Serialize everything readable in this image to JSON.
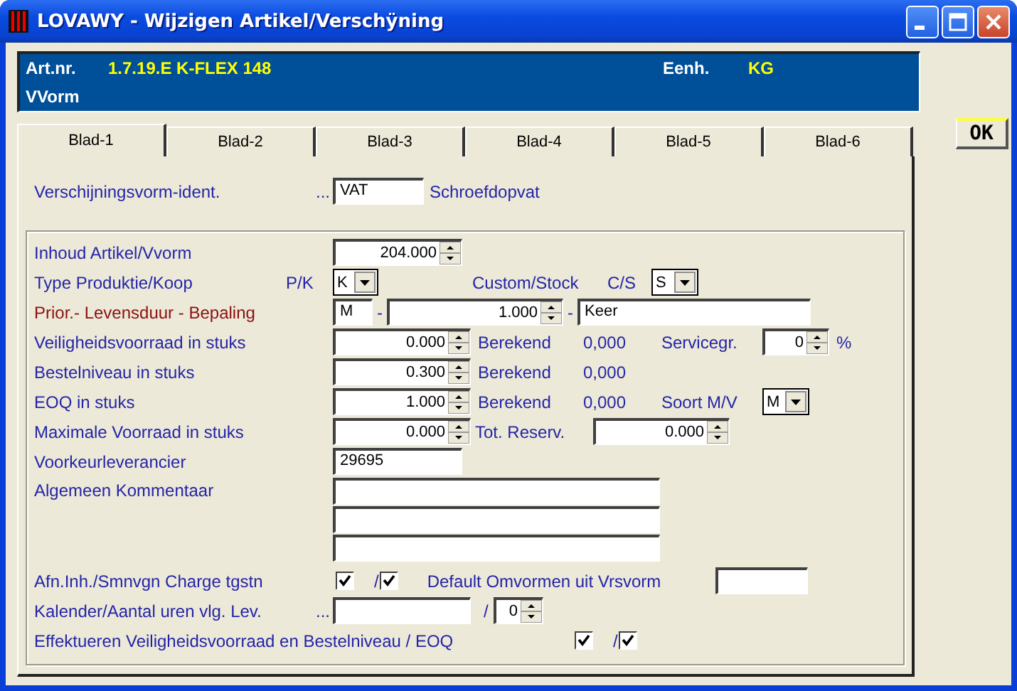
{
  "window": {
    "title": "LOVAWY - Wijzigen Artikel/Verschÿning"
  },
  "header": {
    "article_label": "Art.nr.",
    "article_value": "1.7.19.E  K-FLEX 148",
    "unit_label": "Eenh.",
    "unit_value": "KG",
    "form_label": "VVorm"
  },
  "tabs": [
    {
      "label": "Blad-1",
      "selected": true
    },
    {
      "label": "Blad-2",
      "selected": false
    },
    {
      "label": "Blad-3",
      "selected": false
    },
    {
      "label": "Blad-4",
      "selected": false
    },
    {
      "label": "Blad-5",
      "selected": false
    },
    {
      "label": "Blad-6",
      "selected": false
    }
  ],
  "ok_button": {
    "label": "OK"
  },
  "ident": {
    "label": "Verschijningsvorm-ident.",
    "lookup": "...",
    "value": "VAT",
    "description": "Schroefdopvat"
  },
  "inhoud": {
    "label": "Inhoud Artikel/Vvorm",
    "value": "204.000"
  },
  "type": {
    "label": "Type Produktie/Koop",
    "code_label": "P/K",
    "value": "K",
    "custom_label": "Custom/Stock",
    "custom_code_label": "C/S",
    "custom_value": "S"
  },
  "prior": {
    "label": "Prior.- Levensduur - Bepaling",
    "priority": "M",
    "separator_1": "-",
    "duration": "1.000",
    "separator_2": "-",
    "unit": "Keer"
  },
  "safety": {
    "label": "Veiligheidsvoorraad in stuks",
    "value": "0.000",
    "calc_label": "Berekend",
    "calc_value": "0,000",
    "service_label": "Servicegr.",
    "service_value": "0",
    "service_unit": "%"
  },
  "reorder": {
    "label": "Bestelniveau in stuks",
    "value": "0.300",
    "calc_label": "Berekend",
    "calc_value": "0,000"
  },
  "eoq": {
    "label": "EOQ in stuks",
    "value": "1.000",
    "calc_label": "Berekend",
    "calc_value": "0,000",
    "kind_label": "Soort M/V",
    "kind_value": "M"
  },
  "max": {
    "label": "Maximale Voorraad in stuks",
    "value": "0.000",
    "reserved_label": "Tot. Reserv.",
    "reserved_value": "0.000"
  },
  "supplier": {
    "label": "Voorkeurleverancier",
    "value": "29695"
  },
  "comment": {
    "label": "Algemeen Kommentaar"
  },
  "charge": {
    "label": "Afn.Inh./Smnvgn Charge tgstn",
    "checked_1": true,
    "separator": "/",
    "checked_2": true,
    "default_label": "Default Omvormen uit Vrsvorm"
  },
  "calendar": {
    "label": "Kalender/Aantal uren vlg. Lev.",
    "lookup": "...",
    "separator": "/",
    "hours": "0"
  },
  "effect": {
    "label": "Effektueren Veiligheidsvoorraad en Bestelniveau / EOQ",
    "checked_1": true,
    "separator": "/",
    "checked_2": true
  }
}
